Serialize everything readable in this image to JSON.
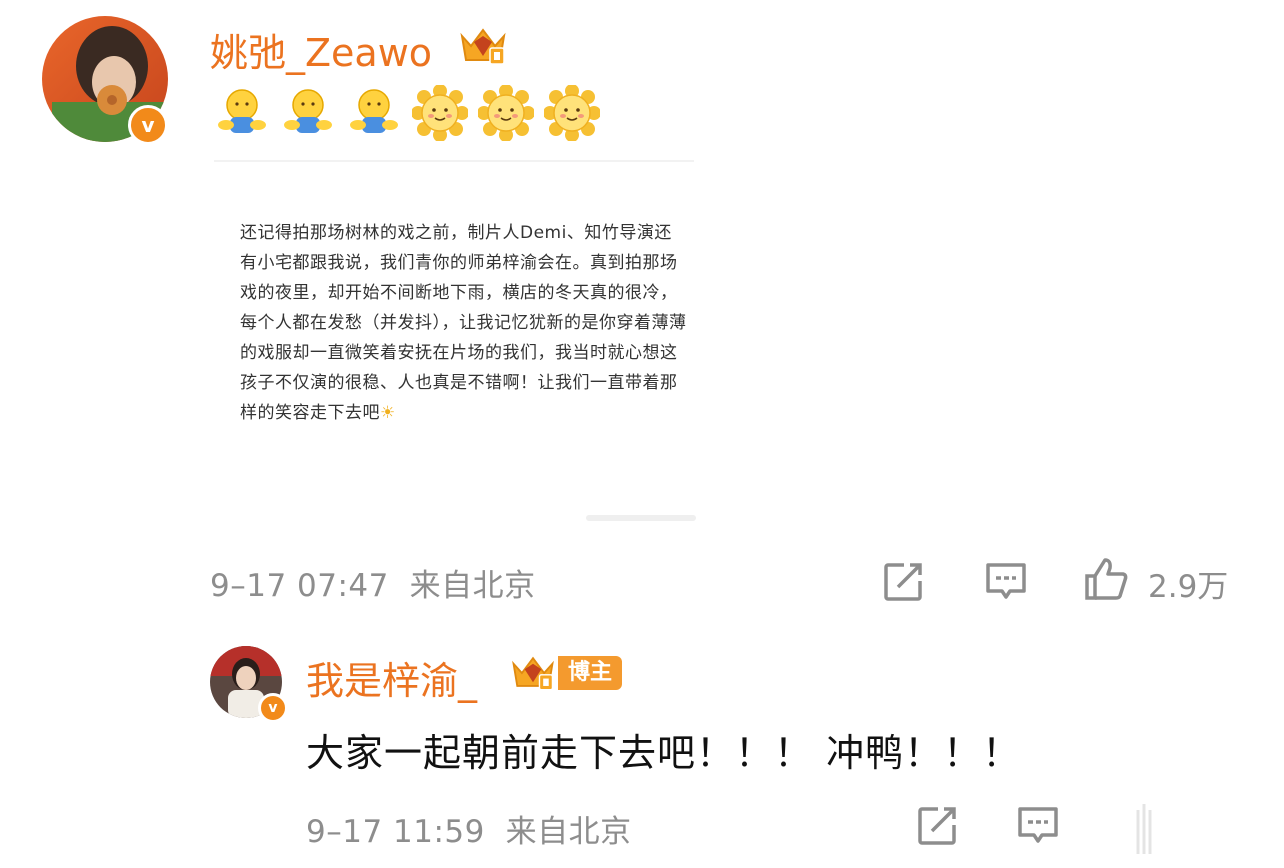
{
  "post": {
    "username": "姚弛_Zeawo",
    "emojis": [
      "hug",
      "hug",
      "hug",
      "sun",
      "sun",
      "sun"
    ],
    "quote_text": "还记得拍那场树林的戏之前，制片人Demi、知竹导演还有小宅都跟我说，我们青你的师弟梓渝会在。真到拍那场戏的夜里，却开始不间断地下雨，横店的冬天真的很冷，每个人都在发愁（并发抖），让我记忆犹新的是你穿着薄薄的戏服却一直微笑着安抚在片场的我们，我当时就心想这孩子不仅演的很稳、人也真是不错啊！让我们一直带着那样的笑容走下去吧",
    "timestamp": "9–17 07:47",
    "location": "来自北京",
    "like_count": "2.9万",
    "verified_label": "v"
  },
  "reply": {
    "username": "我是梓渝_",
    "tag": "博主",
    "text": "大家一起朝前走下去吧！！！ 冲鸭！！！",
    "timestamp": "9–17 11:59",
    "location": "来自北京",
    "verified_label": "v"
  },
  "colors": {
    "accent": "#eb7320",
    "meta": "#8d8d8d",
    "badge": "#f28a1a"
  },
  "icons": [
    "share-icon",
    "comment-icon",
    "like-icon",
    "crown-badge-icon"
  ]
}
